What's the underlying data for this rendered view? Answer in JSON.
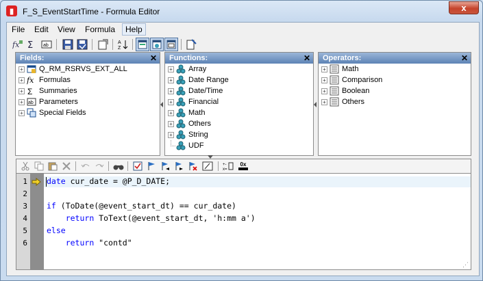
{
  "window": {
    "title": "F_S_EventStartTime - Formula Editor",
    "close_label": "x"
  },
  "menu": [
    {
      "label": "File"
    },
    {
      "label": "Edit"
    },
    {
      "label": "View"
    },
    {
      "label": "Formula"
    },
    {
      "label": "Help"
    }
  ],
  "toolbar": [
    "field-explorer-icon",
    "sum-icon",
    "function-explorer-icon",
    "save-icon",
    "save-close-icon",
    "properties-icon",
    "sort-icon",
    "toggle-fields-icon",
    "toggle-functions-icon",
    "toggle-operators-icon",
    "help-icon"
  ],
  "panels": {
    "fields": {
      "title": "Fields:",
      "items": [
        {
          "label": "Q_RM_RSRVS_EXT_ALL",
          "icon": "table-icon"
        },
        {
          "label": "Formulas",
          "icon": "formula-icon"
        },
        {
          "label": "Summaries",
          "icon": "sum-icon"
        },
        {
          "label": "Parameters",
          "icon": "parameter-icon"
        },
        {
          "label": "Special Fields",
          "icon": "special-field-icon"
        }
      ]
    },
    "functions": {
      "title": "Functions:",
      "items": [
        {
          "label": "Array"
        },
        {
          "label": "Date Range"
        },
        {
          "label": "Date/Time"
        },
        {
          "label": "Financial"
        },
        {
          "label": "Math"
        },
        {
          "label": "Others"
        },
        {
          "label": "String"
        },
        {
          "label": "UDF"
        }
      ]
    },
    "operators": {
      "title": "Operators:",
      "items": [
        {
          "label": "Math"
        },
        {
          "label": "Comparison"
        },
        {
          "label": "Boolean"
        },
        {
          "label": "Others"
        }
      ]
    }
  },
  "editor_toolbar": [
    "cut-icon",
    "copy-icon",
    "paste-icon",
    "delete-icon",
    "undo-icon",
    "redo-icon",
    "find-icon",
    "check-icon",
    "bookmark-icon",
    "prev-bookmark-icon",
    "next-bookmark-icon",
    "clear-bookmarks-icon",
    "comment-icon",
    "syntax-icon",
    "hex-icon"
  ],
  "editor_toolbar_text": {
    "hex": "0x"
  },
  "code": {
    "lines": [
      {
        "num": "1",
        "text": "date cur_date = @P_D_DATE;"
      },
      {
        "num": "2",
        "text": ""
      },
      {
        "num": "3",
        "text": "if (ToDate(@event_start_dt) == cur_date)"
      },
      {
        "num": "4",
        "text": "    return ToText(@event_start_dt, 'h:mm a')"
      },
      {
        "num": "5",
        "text": "else"
      },
      {
        "num": "6",
        "text": "    return \"contd\""
      }
    ]
  },
  "colors": {
    "keyword": "#0000ff",
    "header": "#5d83b5",
    "close": "#c6442c"
  }
}
